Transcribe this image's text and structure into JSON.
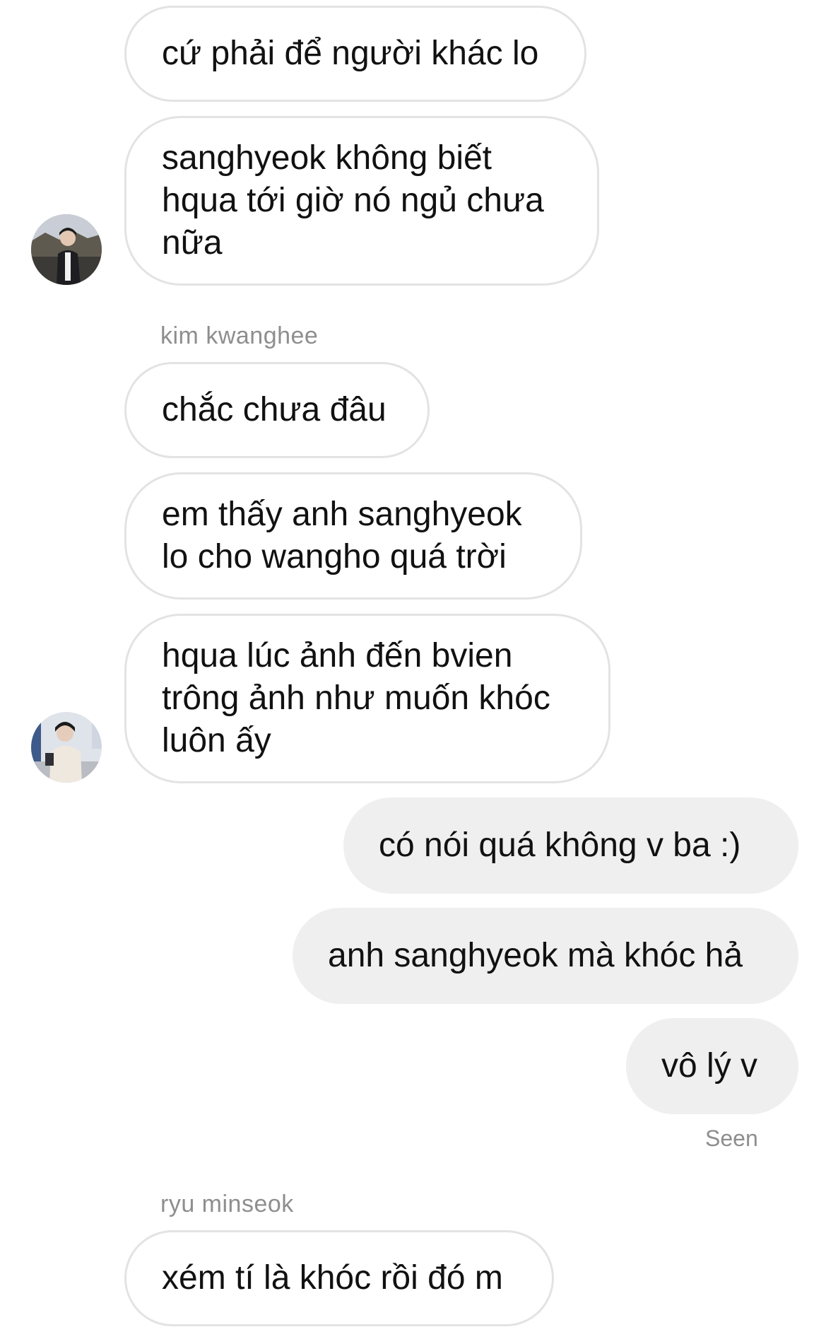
{
  "messages": [
    {
      "text": "cứ phải để người khác lo"
    },
    {
      "text": "sanghyeok không biết\nhqua tới giờ nó ngủ chưa\nnữa"
    },
    {
      "text": "chắc chưa đâu"
    },
    {
      "text": "em thấy anh sanghyeok\nlo cho wangho quá trời"
    },
    {
      "text": "hqua lúc ảnh đến bvien\ntrông ảnh như muốn khóc\nluôn ấy"
    },
    {
      "text": "có nói quá không v ba :)"
    },
    {
      "text": "anh sanghyeok mà khóc hả"
    },
    {
      "text": "vô lý v"
    },
    {
      "text": "xém tí là khóc rồi đó m"
    }
  ],
  "senders": {
    "kwanghee": "kim kwanghee",
    "minseok": "ryu minseok"
  },
  "status": {
    "seen": "Seen"
  },
  "colors": {
    "incoming_border": "#e3e3e3",
    "outgoing_bg": "#efefef",
    "meta_text": "#8e8e8e"
  },
  "icons": {
    "avatar_1": "profile-photo-avatar",
    "avatar_2": "profile-photo-avatar"
  }
}
